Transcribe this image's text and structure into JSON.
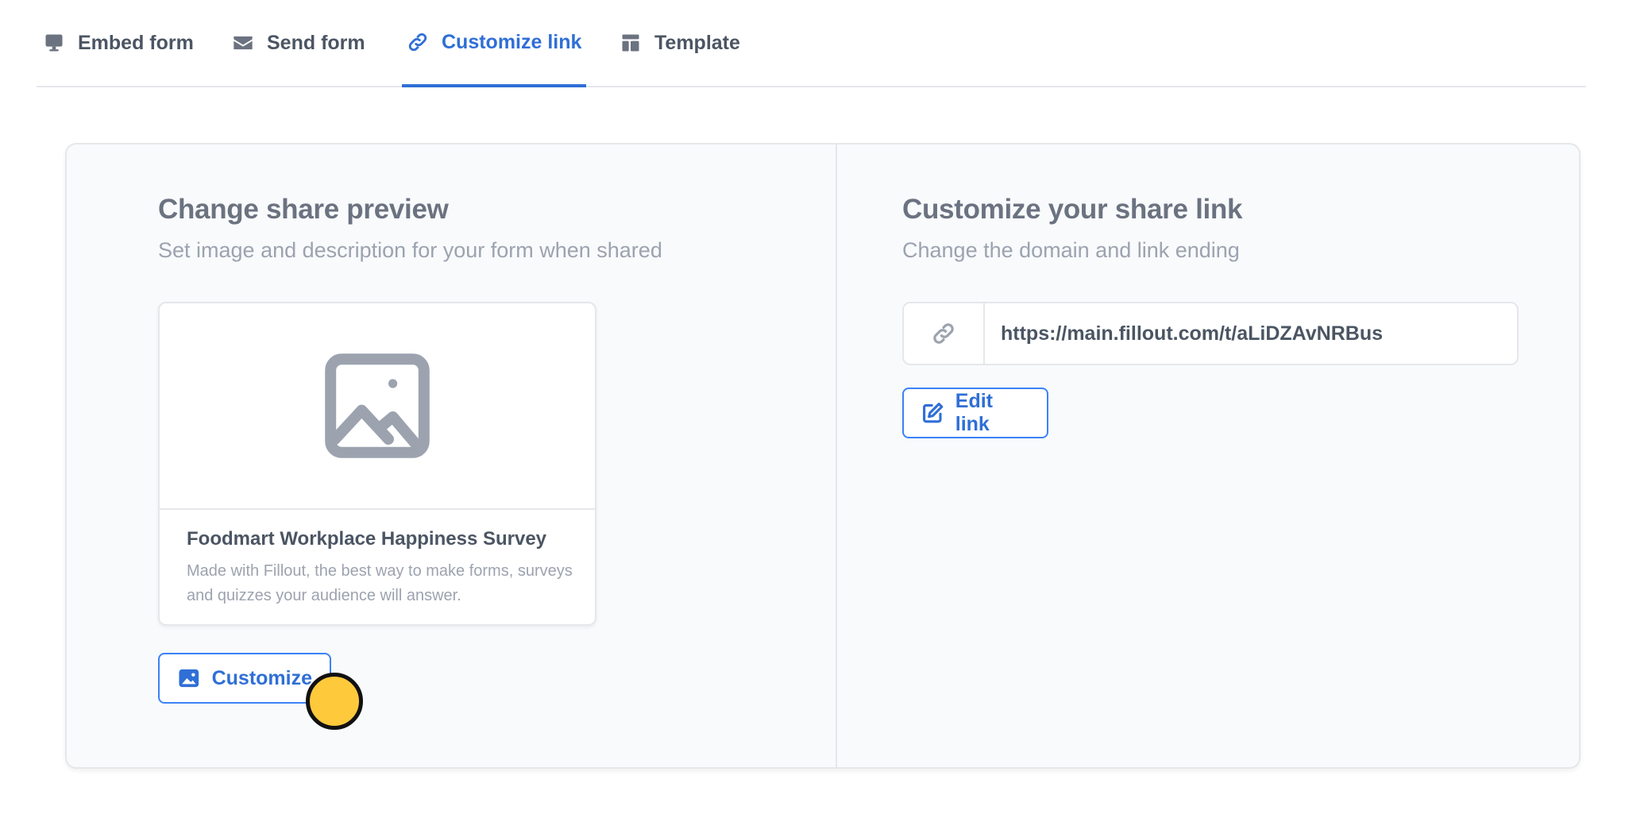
{
  "tabs": [
    {
      "label": "Embed form",
      "icon": "monitor-icon",
      "active": false
    },
    {
      "label": "Send form",
      "icon": "envelope-icon",
      "active": false
    },
    {
      "label": "Customize link",
      "icon": "link-icon",
      "active": true
    },
    {
      "label": "Template",
      "icon": "template-icon",
      "active": false
    }
  ],
  "share_preview": {
    "title": "Change share preview",
    "subtitle": "Set image and description for your form when shared",
    "card": {
      "image_icon": "image-placeholder-icon",
      "title": "Foodmart Workplace Happiness Survey",
      "description": "Made with Fillout, the best way to make forms, surveys and quizzes your audience will answer."
    },
    "button_label": "Customize",
    "button_icon": "image-icon"
  },
  "share_link": {
    "title": "Customize your share link",
    "subtitle": "Change the domain and link ending",
    "url": "https://main.fillout.com/t/aLiDZAvNRBus",
    "url_icon": "link-icon",
    "button_label": "Edit link",
    "button_icon": "edit-icon"
  },
  "colors": {
    "accent": "#2f6fd6",
    "cursor": "#ffc93c"
  }
}
